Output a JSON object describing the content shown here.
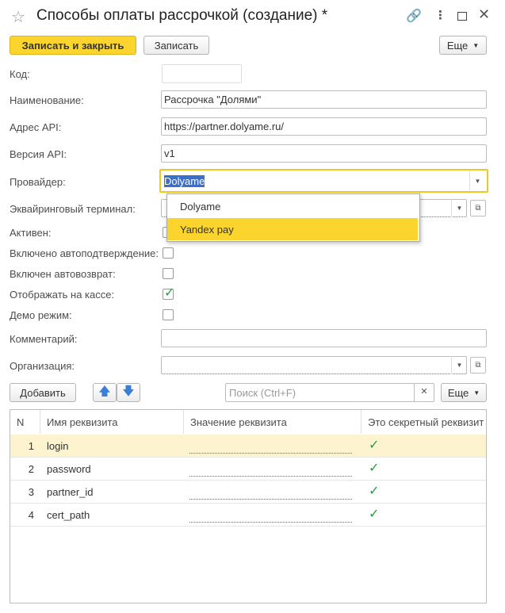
{
  "window": {
    "title": "Способы оплаты рассрочкой (создание) *"
  },
  "toolbar": {
    "save_close_label": "Записать и закрыть",
    "save_label": "Записать",
    "more_label": "Еще"
  },
  "form": {
    "code_label": "Код:",
    "code_value": "",
    "name_label": "Наименование:",
    "name_value": "Рассрочка \"Долями\"",
    "api_address_label": "Адрес API:",
    "api_address_value": "https://partner.dolyame.ru/",
    "api_version_label": "Версия API:",
    "api_version_value": "v1",
    "provider_label": "Провайдер:",
    "provider_value": "Dolyame",
    "terminal_label": "Эквайринговый терминал:",
    "terminal_value": "",
    "active_label": "Активен:",
    "autoconfirm_label": "Включено автоподтверждение:",
    "autoreturn_label": "Включен автовозврат:",
    "show_on_cashier_label": "Отображать на кассе:",
    "demo_label": "Демо режим:",
    "comment_label": "Комментарий:",
    "comment_value": "",
    "organization_label": "Организация:",
    "organization_value": ""
  },
  "checkboxes": {
    "active": false,
    "autoconfirm": false,
    "autoreturn": false,
    "show_on_cashier": true,
    "demo": false
  },
  "provider_dropdown": {
    "options": [
      "Dolyame",
      "Yandex pay"
    ],
    "highlighted": "Yandex pay"
  },
  "table_toolbar": {
    "add_label": "Добавить",
    "search_placeholder": "Поиск (Ctrl+F)",
    "more_label": "Еще"
  },
  "table": {
    "columns": [
      "N",
      "Имя реквизита",
      "Значение реквизита",
      "Это секретный реквизит"
    ],
    "rows": [
      {
        "n": "1",
        "name": "login",
        "value": "",
        "secret": true
      },
      {
        "n": "2",
        "name": "password",
        "value": "",
        "secret": true
      },
      {
        "n": "3",
        "name": "partner_id",
        "value": "",
        "secret": true
      },
      {
        "n": "4",
        "name": "cert_path",
        "value": "",
        "secret": true
      }
    ]
  },
  "colors": {
    "accent": "#fbd52e",
    "selected_row": "#fdf3cf",
    "check": "#2b9a3c"
  },
  "icons": [
    "star-icon",
    "link-icon",
    "more-vert-icon",
    "maximize-icon",
    "close-icon",
    "arrow-up-icon",
    "arrow-down-icon",
    "clear-icon",
    "open-icon",
    "chevron-down-icon"
  ]
}
